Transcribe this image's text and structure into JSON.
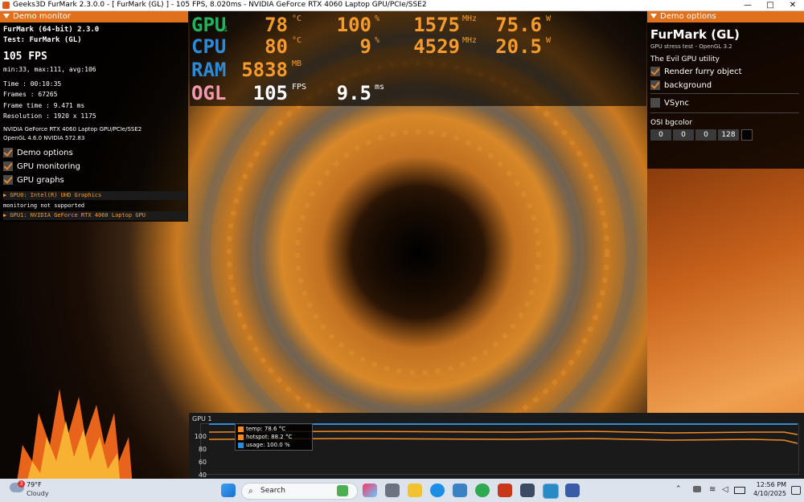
{
  "window": {
    "title": "Geeks3D FurMark 2.3.0.0 - [ FurMark (GL) ] - 105 FPS, 8.020ms - NVIDIA GeForce RTX 4060 Laptop GPU/PCIe/SSE2",
    "minimize": "—",
    "maximize": "□",
    "close": "✕"
  },
  "left_panel": {
    "header": "Demo monitor",
    "app": "FurMark (64-bit) 2.3.0",
    "test": "Test: FurMark (GL)",
    "fps": "105 FPS",
    "fps_stats": "min:33, max:111, avg:106",
    "stats": [
      "Time       : 00:10:35",
      "Frames     : 67265",
      "Frame time : 9.471 ms",
      "Resolution : 1920 x 1175"
    ],
    "gpu_name": "NVIDIA GeForce RTX 4060 Laptop GPU/PCIe/SSE2",
    "opengl": "OpenGL 4.6.0 NVIDIA 572.83",
    "options": [
      {
        "label": "Demo options",
        "checked": true
      },
      {
        "label": "GPU monitoring",
        "checked": true
      },
      {
        "label": "GPU graphs",
        "checked": true
      }
    ],
    "gpu_list": [
      "▶ GPU0: Intel(R) UHD Graphics",
      "monitoring not supported",
      "▶ GPU1: NVIDIA GeForce RTX 4060 Laptop GPU"
    ]
  },
  "osi": {
    "gpu": {
      "label": "GPU",
      "sub": "1",
      "temp": "78",
      "temp_unit": "°C",
      "usage": "100",
      "usage_unit": "%",
      "clock": "1575",
      "clock_unit": "MHz",
      "power": "75.6",
      "power_unit": "W"
    },
    "cpu": {
      "label": "CPU",
      "temp": "80",
      "temp_unit": "°C",
      "usage": "9",
      "usage_unit": "%",
      "clock": "4529",
      "clock_unit": "MHz",
      "power": "20.5",
      "power_unit": "W"
    },
    "ram": {
      "label": "RAM",
      "value": "5838",
      "unit": "MB"
    },
    "ogl": {
      "label": "OGL",
      "fps": "105",
      "fps_unit": "FPS",
      "frametime": "9.5",
      "frametime_unit": "ms"
    },
    "colors": {
      "gpu": "#22b35a",
      "cpu": "#2d8bd6",
      "ram": "#2d8bd6",
      "ogl": "#f49ab0",
      "value": "#f59a2c"
    }
  },
  "right_panel": {
    "header": "Demo options",
    "title": "FurMark (GL)",
    "subtitle": "GPU stress test - OpenGL 3.2",
    "section": "The Evil GPU utility",
    "options": [
      {
        "label": "Render furry object",
        "checked": true
      },
      {
        "label": "background",
        "checked": true
      }
    ],
    "vsync": {
      "label": "VSync",
      "checked": false
    },
    "osi_bgcolor": {
      "label": "OSI bgcolor",
      "values": [
        "0",
        "0",
        "0",
        "128"
      ]
    }
  },
  "graph": {
    "title": "GPU 1",
    "y_ticks": [
      "100",
      "80",
      "60",
      "40"
    ],
    "legend": [
      {
        "label": "temp: 78.6 °C",
        "color": "#f08a24"
      },
      {
        "label": "hotspot: 88.2 °C",
        "color": "#f08a24"
      },
      {
        "label": "usage: 100.0 %",
        "color": "#2d8bd6"
      }
    ]
  },
  "taskbar": {
    "weather_temp": "79°F",
    "weather_desc": "Cloudy",
    "weather_badge": "3",
    "search_placeholder": "Search",
    "time": "12:56 PM",
    "date": "4/10/2025"
  }
}
